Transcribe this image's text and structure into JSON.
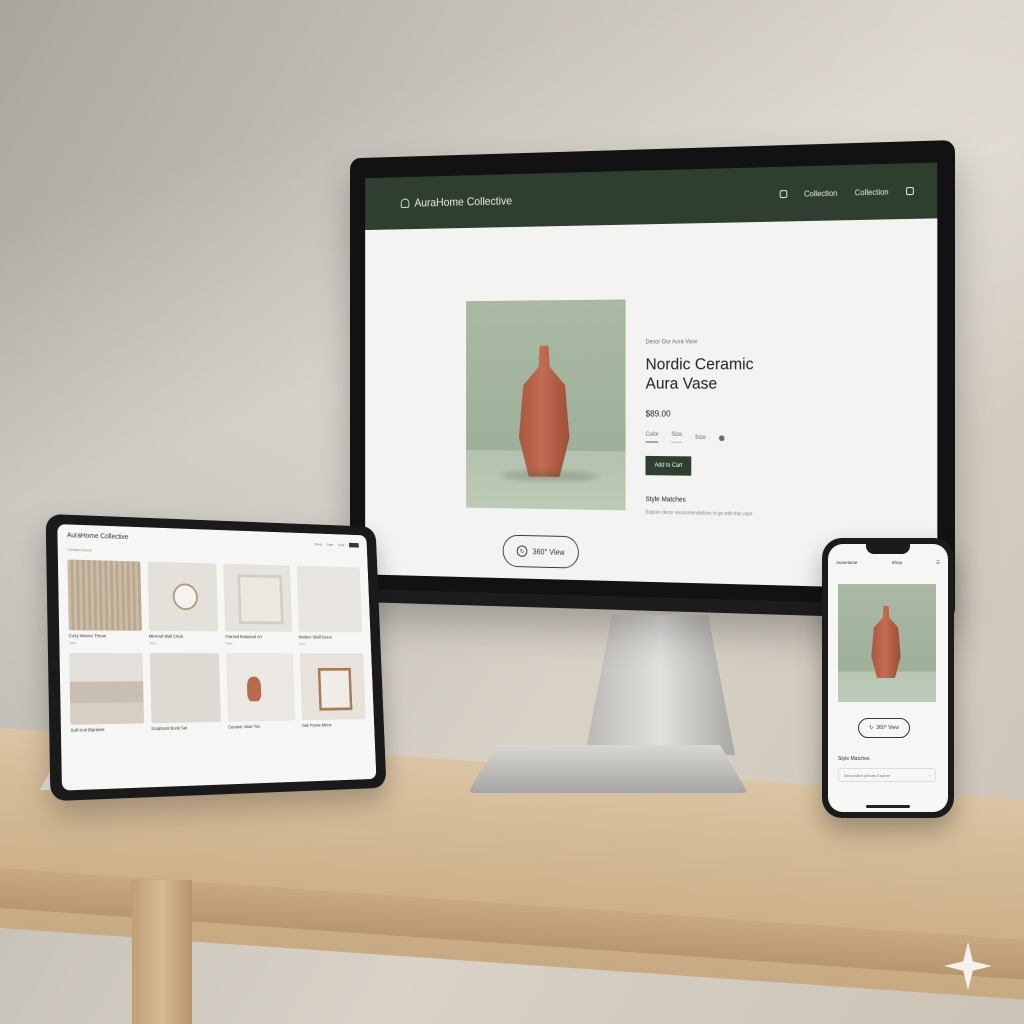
{
  "desktop": {
    "brand": "AuraHome Collective",
    "nav": [
      "Collection",
      "Collection"
    ],
    "breadcrumb": "Decor  Our Aura Vase",
    "product_title_line1": "Nordic Ceramic",
    "product_title_line2": "Aura Vase",
    "price": "$89.00",
    "option_color": "Color",
    "option_size": "Size",
    "option_other": "Size",
    "add_to_cart": "Add to Cart",
    "style_matches_title": "Style Matches",
    "style_matches_text": "Explore decor recommendations to go with this vase",
    "view_360": "360° View"
  },
  "tablet": {
    "brand": "AuraHome Collective",
    "nav": [
      "Shop",
      "Sale",
      "Cart"
    ],
    "subheading": "Curated Decor",
    "products": [
      {
        "name": "Cozy Woven Throw",
        "sub": "View"
      },
      {
        "name": "Minimal Wall Clock",
        "sub": "View"
      },
      {
        "name": "Framed Botanical Art",
        "sub": "View"
      },
      {
        "name": "Modern Shelf Decor",
        "sub": "View"
      },
      {
        "name": "Soft Knit Blankets",
        "sub": ""
      },
      {
        "name": "Sculptural Book Set",
        "sub": ""
      },
      {
        "name": "Ceramic Vase Trio",
        "sub": ""
      },
      {
        "name": "Oak Frame Mirror",
        "sub": ""
      }
    ]
  },
  "phone": {
    "brand": "AuraHome",
    "nav_link": "Shop",
    "menu_icon": "menu-icon",
    "view_360": "360° View",
    "style_matches": "Style Matches",
    "row_label": "Decorative pieces  Explore"
  },
  "colors": {
    "brand_green": "#2e3f30",
    "terracotta": "#b76a4e",
    "sage": "#a9b9a4"
  }
}
